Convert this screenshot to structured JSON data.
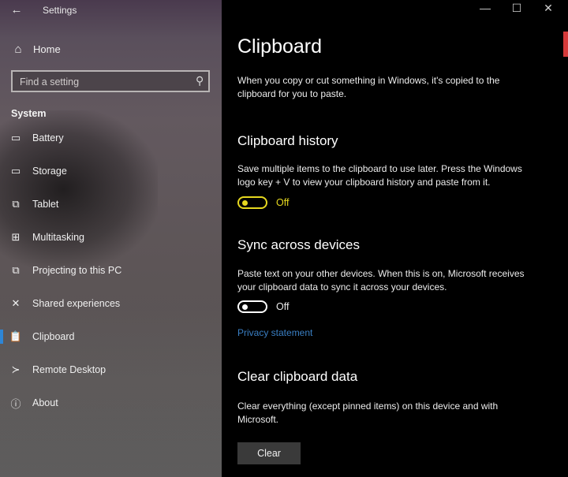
{
  "window": {
    "title": "Settings",
    "back_icon": "←",
    "minimize_icon": "—",
    "maximize_icon": "☐",
    "close_icon": "✕"
  },
  "sidebar": {
    "home_label": "Home",
    "search_placeholder": "Find a setting",
    "section_title": "System",
    "items": [
      {
        "label": "Battery",
        "icon": "battery-icon",
        "glyph": "▭"
      },
      {
        "label": "Storage",
        "icon": "storage-icon",
        "glyph": "▭"
      },
      {
        "label": "Tablet",
        "icon": "tablet-icon",
        "glyph": "⧉"
      },
      {
        "label": "Multitasking",
        "icon": "multitasking-icon",
        "glyph": "⊞"
      },
      {
        "label": "Projecting to this PC",
        "icon": "projecting-icon",
        "glyph": "⧉"
      },
      {
        "label": "Shared experiences",
        "icon": "shared-experiences-icon",
        "glyph": "✕"
      },
      {
        "label": "Clipboard",
        "icon": "clipboard-icon",
        "glyph": "📋",
        "selected": true
      },
      {
        "label": "Remote Desktop",
        "icon": "remote-desktop-icon",
        "glyph": "≻"
      },
      {
        "label": "About",
        "icon": "about-icon",
        "glyph": "ⓘ"
      }
    ]
  },
  "main": {
    "title": "Clipboard",
    "intro": "When you copy or cut something in Windows, it's copied to the clipboard for you to paste.",
    "history": {
      "heading": "Clipboard history",
      "description": "Save multiple items to the clipboard to use later. Press the Windows logo key + V to view your clipboard history and paste from it.",
      "toggle_state": "Off"
    },
    "sync": {
      "heading": "Sync across devices",
      "description": "Paste text on your other devices. When this is on, Microsoft receives your clipboard data to sync it across your devices.",
      "toggle_state": "Off",
      "privacy_link": "Privacy statement"
    },
    "clear": {
      "heading": "Clear clipboard data",
      "description": "Clear everything (except pinned items) on this device and with Microsoft.",
      "button_label": "Clear"
    }
  },
  "colors": {
    "accent": "#2e86d6",
    "toggle_focus": "#e6d81f",
    "link": "#3a7fc4"
  }
}
